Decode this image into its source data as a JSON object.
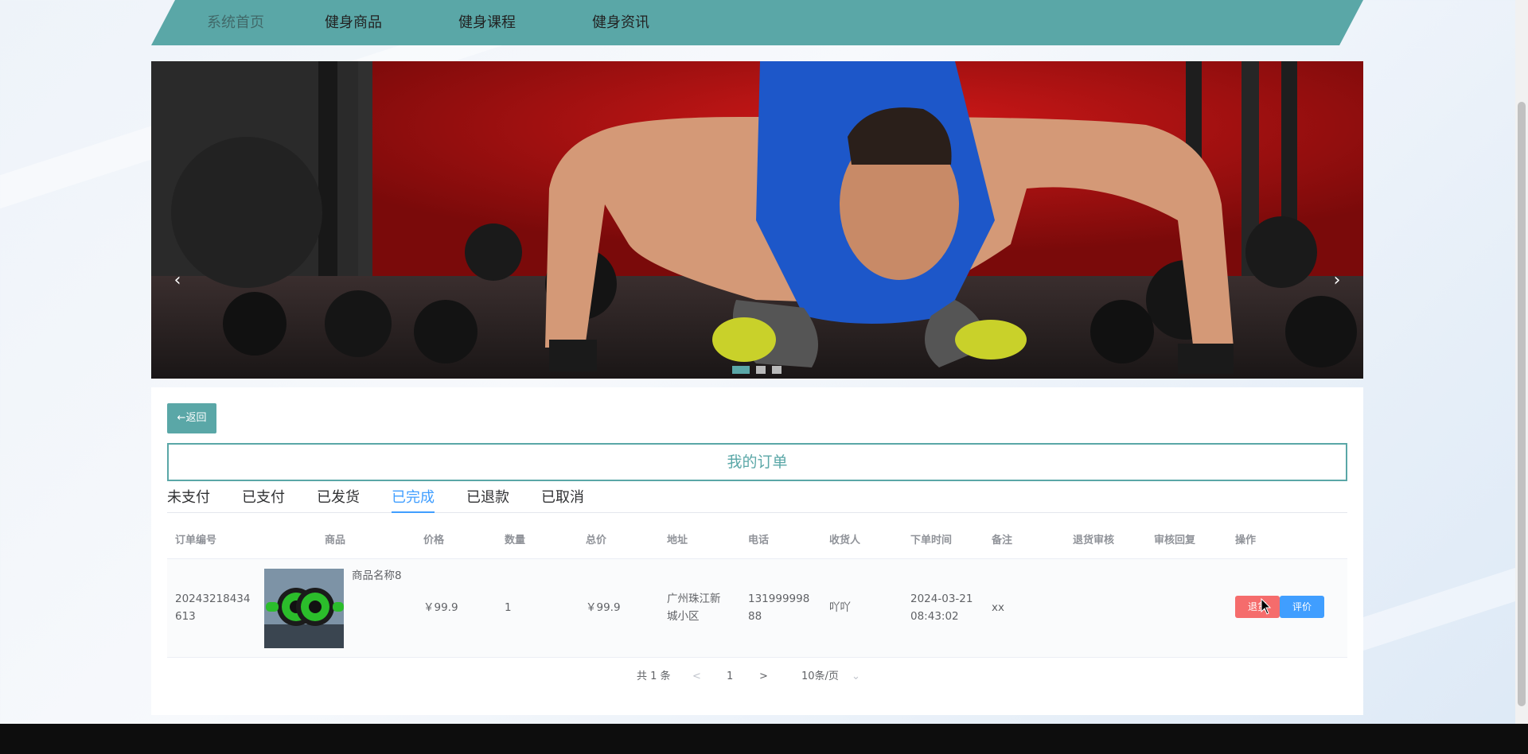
{
  "nav": {
    "items": [
      "系统首页",
      "健身商品",
      "健身课程",
      "健身资讯"
    ]
  },
  "banner": {
    "prev": "‹",
    "next": "›",
    "slide_count": 3,
    "active_slide": 1
  },
  "back_button": "←返回",
  "page_title": "我的订单",
  "tabs": [
    "未支付",
    "已支付",
    "已发货",
    "已完成",
    "已退款",
    "已取消"
  ],
  "active_tab": "已完成",
  "table": {
    "headers": [
      "订单编号",
      "商品",
      "价格",
      "数量",
      "总价",
      "地址",
      "电话",
      "收货人",
      "下单时间",
      "备注",
      "退货审核",
      "审核回复",
      "操作"
    ],
    "rows": [
      {
        "order_no_1": "20243218434",
        "order_no_2": "613",
        "product_name": "商品名称8",
        "price": "￥99.9",
        "quantity": "1",
        "total": "￥99.9",
        "address_1": "广州珠江新",
        "address_2": "城小区",
        "phone_1": "131999998",
        "phone_2": "88",
        "receiver": "吖吖",
        "time_1": "2024-03-21",
        "time_2": "08:43:02",
        "remark": "xx",
        "return_label": "退货",
        "review_label": "评价"
      }
    ]
  },
  "pager": {
    "total": "共 1 条",
    "prev": "<",
    "page": "1",
    "next": ">",
    "size": "10条/页",
    "size_arrow": "⌄"
  },
  "colors": {
    "accent": "#5aa7a7",
    "link": "#409eff",
    "danger": "#f56c6c"
  }
}
